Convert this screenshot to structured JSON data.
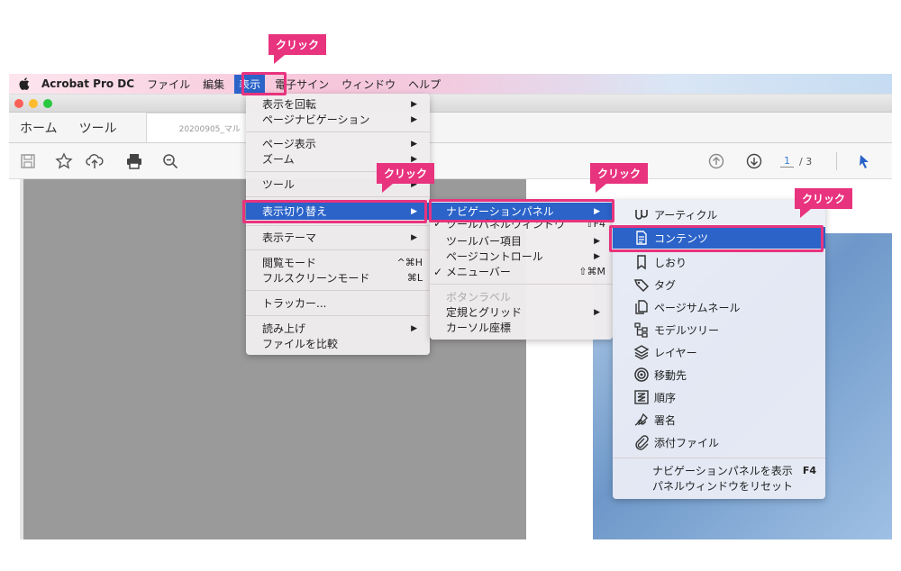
{
  "menubar": {
    "app": "Acrobat Pro DC",
    "items": [
      "ファイル",
      "編集",
      "表示",
      "電子サイン",
      "ウィンドウ",
      "ヘルプ"
    ]
  },
  "tabs": {
    "home": "ホーム",
    "tools": "ツール",
    "doc": "20200905_マル"
  },
  "toolbar": {
    "page_current": "1",
    "page_total": "/ 3"
  },
  "view_menu": {
    "items": [
      "表示を回転",
      "ページナビゲーション",
      "ページ表示",
      "ズーム",
      "ツール",
      "表示切り替え",
      "表示テーマ",
      "閲覧モード",
      "フルスクリーンモード",
      "トラッカー...",
      "読み上げ",
      "ファイルを比較"
    ],
    "shortcuts": {
      "reading_mode": "^⌘H",
      "fullscreen": "⌘L"
    }
  },
  "toggle_menu": {
    "items": [
      "ナビゲーションパネル",
      "ツールパネルウィンドウ",
      "ツールバー項目",
      "ページコントロール",
      "メニューバー",
      "ボタンラベル",
      "定規とグリッド",
      "カーソル座標"
    ],
    "shortcuts": {
      "tool_panel": "⇧F4",
      "menubar": "⇧⌘M"
    }
  },
  "nav_menu": {
    "items": [
      "アーティクル",
      "コンテンツ",
      "しおり",
      "タグ",
      "ページサムネール",
      "モデルツリー",
      "レイヤー",
      "移動先",
      "順序",
      "署名",
      "添付ファイル"
    ],
    "footer": [
      "ナビゲーションパネルを表示",
      "パネルウィンドウをリセット"
    ],
    "footer_shortcut": "F4"
  },
  "callouts": [
    "クリック",
    "クリック",
    "クリック",
    "クリック"
  ],
  "colors": {
    "highlight": "#2b63c9",
    "annotation": "#e8337e"
  }
}
